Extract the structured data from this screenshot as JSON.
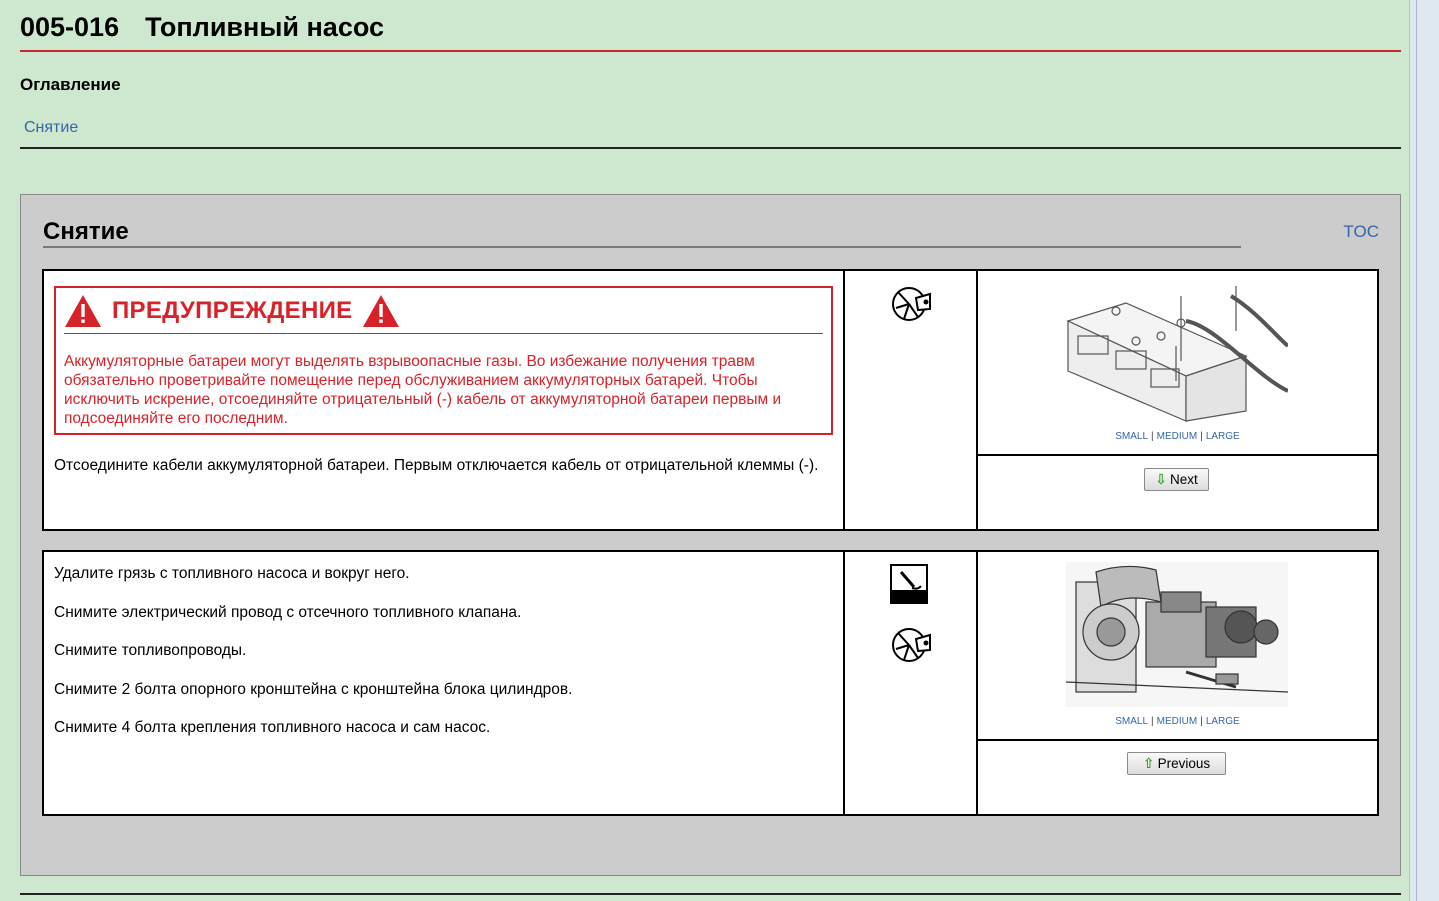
{
  "page": {
    "code": "005-016",
    "title": "Топливный насос",
    "toc_heading": "Оглавление",
    "toc_link": "Снятие"
  },
  "section": {
    "title": "Снятие",
    "toc_link": "TOC"
  },
  "warning": {
    "title": "ПРЕДУПРЕЖДЕНИЕ",
    "text": "Аккумуляторные батареи могут выделять взрывоопасные газы. Во избежание получения травм обязательно проветривайте помещение перед обслуживанием аккумуляторных батарей. Чтобы исключить искрение, отсоединяйте отрицательный (-) кабель от аккумуляторной батареи первым и подсоединяйте его последним."
  },
  "steps": [
    {
      "text": "Отсоедините кабели аккумуляторной батареи. Первым отключается кабель от отрицательной клеммы (-).",
      "icons": [
        "wrench-socket-icon"
      ],
      "size_links": [
        "SMALL",
        "MEDIUM",
        "LARGE"
      ],
      "nav_button": "Next",
      "nav_icon": "arrow-down-icon"
    },
    {
      "lines": [
        "Удалите грязь с топливного насоса и вокруг него.",
        "Снимите электрический провод с отсечного топливного клапана.",
        "Снимите топливопроводы.",
        "Снимите 2 болта опорного кронштейна с кронштейна блока цилиндров.",
        "Снимите 4 болта крепления топливного насоса и сам насос."
      ],
      "icons": [
        "gauge-icon",
        "wrench-socket-icon"
      ],
      "size_links": [
        "SMALL",
        "MEDIUM",
        "LARGE"
      ],
      "nav_button": "Previous",
      "nav_icon": "arrow-up-icon"
    }
  ],
  "colors": {
    "background": "#cde8cf",
    "warning": "#d8222a",
    "link": "#3566a8",
    "section_bg": "#cccccc"
  }
}
